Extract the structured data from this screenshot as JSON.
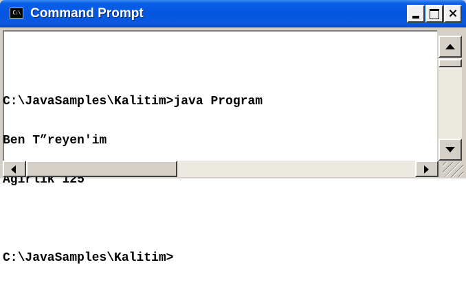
{
  "window": {
    "title": "Command Prompt",
    "app_icon_text": "C:\\",
    "buttons": {
      "minimize": "minimize",
      "maximize": "maximize",
      "close": "×"
    }
  },
  "console": {
    "lines": [
      "",
      "C:\\JavaSamples\\Kalitim>java Program",
      "Ben T”reyen'im",
      "Agirlik 125",
      "",
      "C:\\JavaSamples\\Kalitim>"
    ]
  },
  "colors": {
    "titlebar": "#0456e0",
    "console_bg": "#ffffff",
    "console_text": "#000000",
    "chrome": "#d4d0c8"
  },
  "icons": {
    "app": "console-icon",
    "minimize": "minimize-icon",
    "maximize": "maximize-icon",
    "close": "close-icon"
  }
}
